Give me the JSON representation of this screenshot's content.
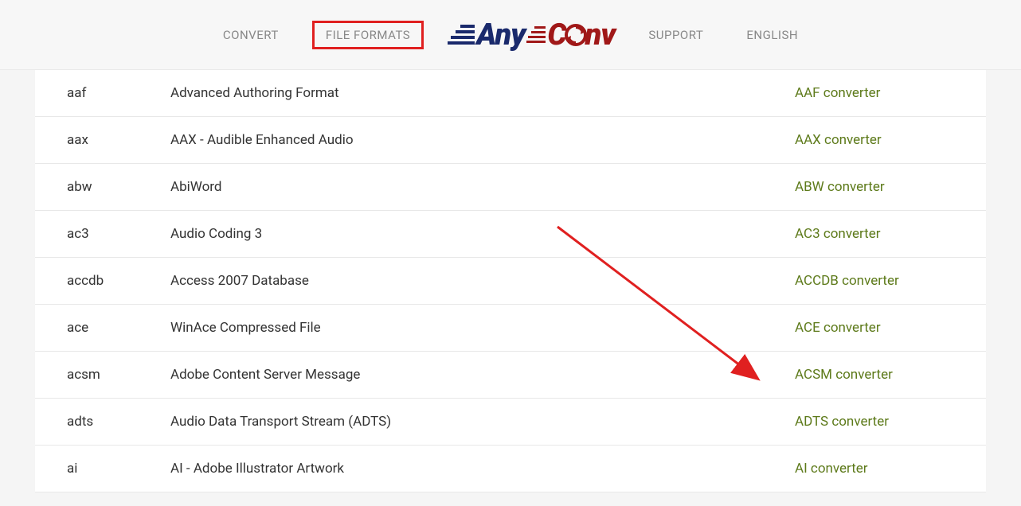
{
  "nav": {
    "convert": "CONVERT",
    "file_formats": "FILE FORMATS",
    "support": "SUPPORT",
    "english": "ENGLISH"
  },
  "logo": {
    "text_any": "Any",
    "text_c": "C",
    "text_nv": "nv"
  },
  "formats": [
    {
      "ext": "aaf",
      "desc": "Advanced Authoring Format",
      "link": "AAF converter"
    },
    {
      "ext": "aax",
      "desc": "AAX - Audible Enhanced Audio",
      "link": "AAX converter"
    },
    {
      "ext": "abw",
      "desc": "AbiWord",
      "link": "ABW converter"
    },
    {
      "ext": "ac3",
      "desc": "Audio Coding 3",
      "link": "AC3 converter"
    },
    {
      "ext": "accdb",
      "desc": "Access 2007 Database",
      "link": "ACCDB converter"
    },
    {
      "ext": "ace",
      "desc": "WinAce Compressed File",
      "link": "ACE converter"
    },
    {
      "ext": "acsm",
      "desc": "Adobe Content Server Message",
      "link": "ACSM converter"
    },
    {
      "ext": "adts",
      "desc": "Audio Data Transport Stream (ADTS)",
      "link": "ADTS converter"
    },
    {
      "ext": "ai",
      "desc": "AI - Adobe Illustrator Artwork",
      "link": "AI converter"
    }
  ]
}
